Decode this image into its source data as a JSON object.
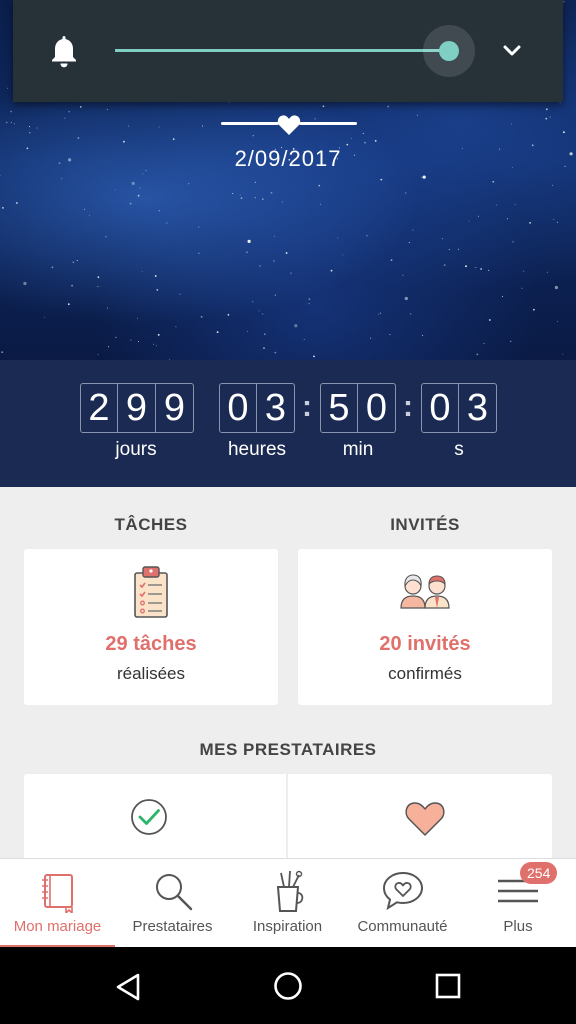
{
  "notification": {
    "bell_icon": "bell-icon",
    "volume_level": 0.96,
    "expand_icon": "chevron-down-icon"
  },
  "hero": {
    "date": "2/09/2017",
    "heart_icon": "heart-icon"
  },
  "countdown": {
    "days_digits": [
      "2",
      "9",
      "9"
    ],
    "hours_digits": [
      "0",
      "3"
    ],
    "minutes_digits": [
      "5",
      "0"
    ],
    "seconds_digits": [
      "0",
      "3"
    ],
    "separator": ":",
    "labels": {
      "days": "jours",
      "hours": "heures",
      "minutes": "min",
      "seconds": "s"
    }
  },
  "sections": {
    "tasks": {
      "title": "TÂCHES",
      "count": "29 tâches",
      "status": "réalisées",
      "icon": "clipboard-icon"
    },
    "guests": {
      "title": "INVITÉS",
      "count": "20 invités",
      "status": "confirmés",
      "icon": "couple-icon"
    },
    "vendors": {
      "title": "MES PRESTATAIRES",
      "left_icon": "check-circle-icon",
      "right_icon": "heart-icon"
    }
  },
  "bottom_nav": {
    "items": [
      {
        "label": "Mon mariage",
        "icon": "notebook-icon",
        "active": true
      },
      {
        "label": "Prestataires",
        "icon": "search-icon",
        "active": false
      },
      {
        "label": "Inspiration",
        "icon": "cup-brushes-icon",
        "active": false
      },
      {
        "label": "Communauté",
        "icon": "chat-heart-icon",
        "active": false
      },
      {
        "label": "Plus",
        "icon": "menu-icon",
        "active": false
      }
    ],
    "badge": "254"
  },
  "colors": {
    "accent": "#e0706b",
    "countdown_bg": "#1b2a52",
    "slider": "#7fcfc4",
    "notif_bg": "#263238"
  },
  "system_nav": {
    "icons": [
      "back-icon",
      "home-icon",
      "recents-icon"
    ]
  }
}
